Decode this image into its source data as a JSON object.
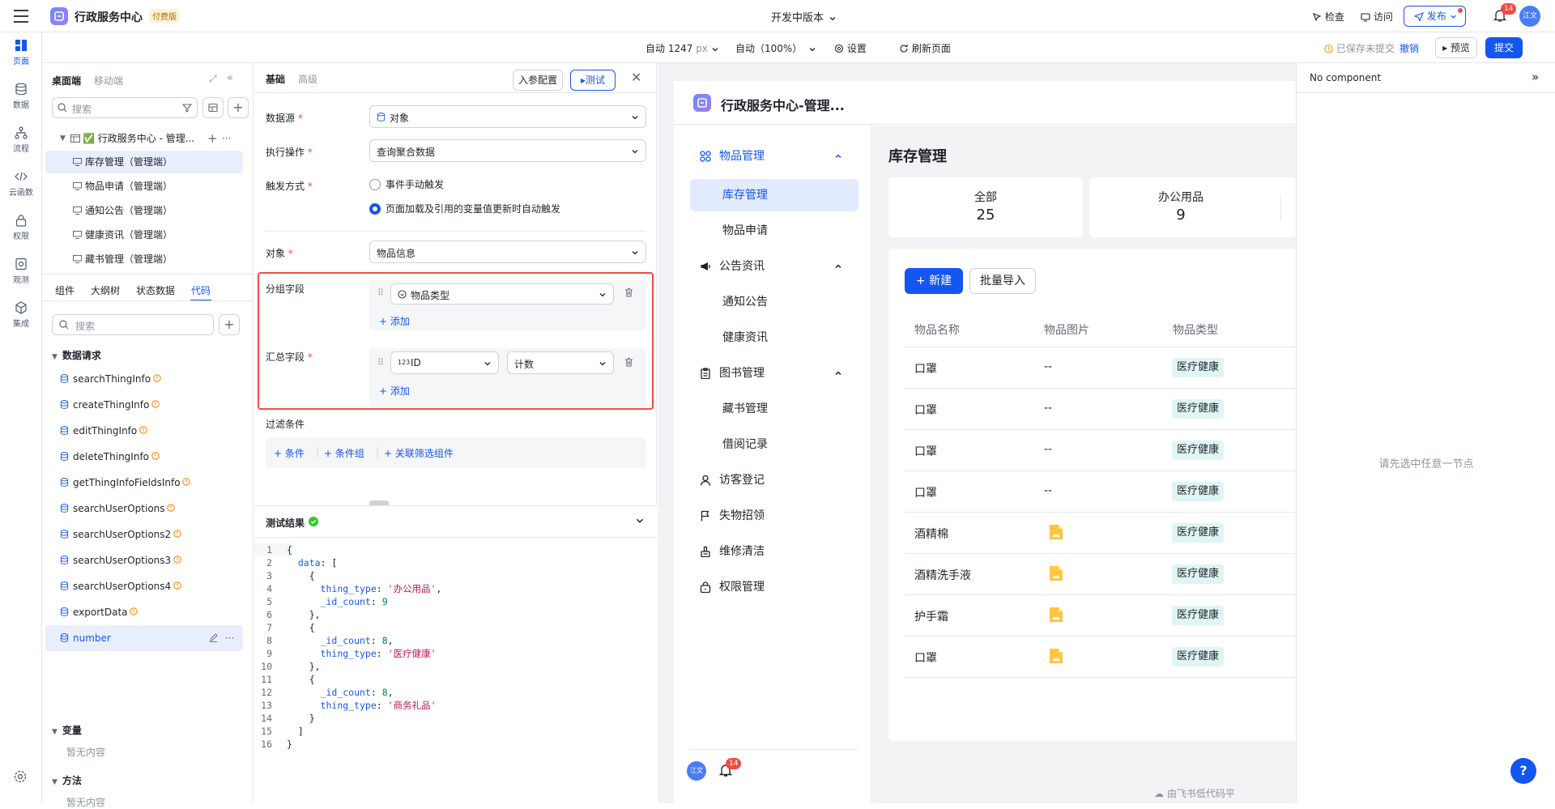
{
  "topbar": {
    "app_title": "行政服务中心",
    "plan_badge": "付费版",
    "version_label": "开发中版本",
    "inspect_label": "检查",
    "visit_label": "访问",
    "publish_label": "发布",
    "notification_count": "14",
    "avatar_text": "江文"
  },
  "subbar": {
    "width_value": "自动 1247",
    "width_unit": "px",
    "zoom_label": "自动（100%）",
    "settings_label": "设置",
    "refresh_label": "刷新页面",
    "unsaved_text": "已保存未提交",
    "undo_label": "撤销",
    "preview_label": "预览",
    "submit_label": "提交"
  },
  "rail": {
    "items": [
      {
        "label": "页面",
        "icon": "page-icon"
      },
      {
        "label": "数据",
        "icon": "database-icon"
      },
      {
        "label": "流程",
        "icon": "flow-icon"
      },
      {
        "label": "云函数",
        "icon": "code-icon"
      },
      {
        "label": "权限",
        "icon": "lock-icon"
      },
      {
        "label": "观测",
        "icon": "monitor-icon"
      },
      {
        "label": "集成",
        "icon": "integration-icon"
      }
    ]
  },
  "tree": {
    "tab_desktop": "桌面端",
    "tab_mobile": "移动端",
    "search_placeholder": "搜索",
    "root_label": "✅ 行政服务中心 - 管理...",
    "pages": [
      "库存管理（管理端）",
      "物品申请（管理端）",
      "通知公告（管理端）",
      "健康资讯（管理端）",
      "藏书管理（管理端）"
    ],
    "bottom_tabs": [
      "组件",
      "大纲树",
      "状态数据",
      "代码"
    ],
    "code_search_placeholder": "搜索",
    "section_requests": "数据请求",
    "requests": [
      "searchThingInfo",
      "createThingInfo",
      "editThingInfo",
      "deleteThingInfo",
      "getThingInfoFieldsInfo",
      "searchUserOptions",
      "searchUserOptions2",
      "searchUserOptions3",
      "searchUserOptions4",
      "exportData",
      "number"
    ],
    "section_variables": "变量",
    "variables_empty": "暂无内容",
    "section_methods": "方法",
    "methods_empty": "暂无内容"
  },
  "config": {
    "tab_basic": "基础",
    "tab_advanced": "高级",
    "params_button": "入参配置",
    "test_button": "测试",
    "datasource_label": "数据源",
    "datasource_value": "对象",
    "operation_label": "执行操作",
    "operation_value": "查询聚合数据",
    "trigger_label": "触发方式",
    "trigger_manual": "事件手动触发",
    "trigger_auto": "页面加载及引用的变量值更新时自动触发",
    "object_label": "对象",
    "object_value": "物品信息",
    "group_label": "分组字段",
    "group_value": "物品类型",
    "add_label": "添加",
    "summary_label": "汇总字段",
    "summary_field_prefix": "123",
    "summary_field": "ID",
    "summary_func": "计数",
    "filter_label": "过滤条件",
    "filter_condition": "条件",
    "filter_group": "条件组",
    "filter_linked": "关联筛选组件"
  },
  "test_result": {
    "title": "测试结果",
    "lines": [
      {
        "n": "1",
        "html": "{"
      },
      {
        "n": "2",
        "html": "  <span class='k'>data</span>: ["
      },
      {
        "n": "3",
        "html": "    {"
      },
      {
        "n": "4",
        "html": "      <span class='k'>thing_type</span>: <span class='s'>'办公用品'</span>,"
      },
      {
        "n": "5",
        "html": "      <span class='k'>_id_count</span>: <span class='n'>9</span>"
      },
      {
        "n": "6",
        "html": "    },"
      },
      {
        "n": "7",
        "html": "    {"
      },
      {
        "n": "8",
        "html": "      <span class='k'>_id_count</span>: <span class='n'>8</span>,"
      },
      {
        "n": "9",
        "html": "      <span class='k'>thing_type</span>: <span class='s'>'医疗健康'</span>"
      },
      {
        "n": "10",
        "html": "    },"
      },
      {
        "n": "11",
        "html": "    {"
      },
      {
        "n": "12",
        "html": "      <span class='k'>_id_count</span>: <span class='n'>8</span>,"
      },
      {
        "n": "13",
        "html": "      <span class='k'>thing_type</span>: <span class='s'>'商务礼品'</span>"
      },
      {
        "n": "14",
        "html": "    }"
      },
      {
        "n": "15",
        "html": "  ]"
      },
      {
        "n": "16",
        "html": "}"
      }
    ]
  },
  "preview": {
    "app_title": "行政服务中心-管理...",
    "nav": {
      "group1": "物品管理",
      "item1a": "库存管理",
      "item1b": "物品申请",
      "group2": "公告资讯",
      "item2a": "通知公告",
      "item2b": "健康资讯",
      "group3": "图书管理",
      "item3a": "藏书管理",
      "item3b": "借阅记录",
      "item4": "访客登记",
      "item5": "失物招领",
      "item6": "维修清洁",
      "item7": "权限管理"
    },
    "page_title": "库存管理",
    "stat_all_label": "全部",
    "stat_all_value": "25",
    "stat_office_label": "办公用品",
    "stat_office_value": "9",
    "new_button": "新建",
    "import_button": "批量导入",
    "columns": [
      "物品名称",
      "物品图片",
      "物品类型"
    ],
    "rows": [
      {
        "name": "口罩",
        "img": "--",
        "type": "医疗健康"
      },
      {
        "name": "口罩",
        "img": "--",
        "type": "医疗健康"
      },
      {
        "name": "口罩",
        "img": "--",
        "type": "医疗健康"
      },
      {
        "name": "口罩",
        "img": "--",
        "type": "医疗健康"
      },
      {
        "name": "酒精棉",
        "img": "image",
        "type": "医疗健康"
      },
      {
        "name": "酒精洗手液",
        "img": "image",
        "type": "医疗健康"
      },
      {
        "name": "护手霜",
        "img": "image",
        "type": "医疗健康"
      },
      {
        "name": "口罩",
        "img": "image",
        "type": "医疗健康"
      }
    ],
    "footer_avatar": "江文",
    "footer_badge": "14",
    "powered_by": "由飞书低代码平"
  },
  "rpanel": {
    "title": "No component",
    "empty_hint": "请先选中任意一节点"
  },
  "colors": {
    "accent": "#1456f0",
    "highlight_border": "#f54a45",
    "tag_bg": "#dff5f3"
  }
}
